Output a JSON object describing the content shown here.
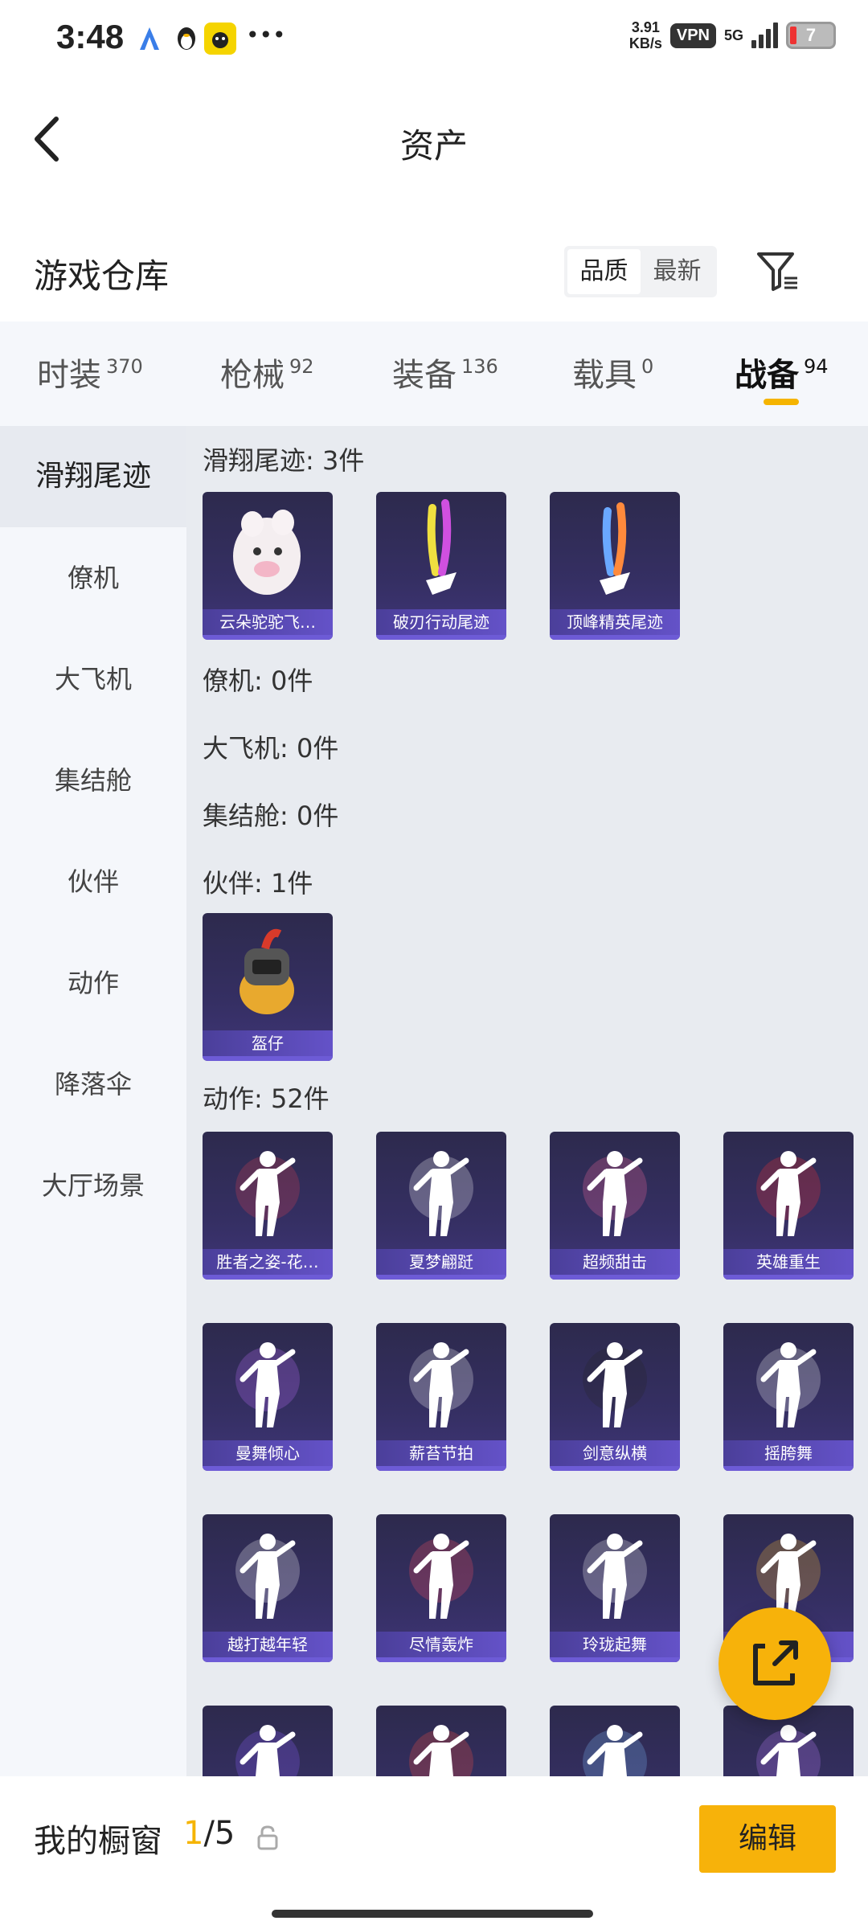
{
  "status_bar": {
    "time": "3:48",
    "speed_value": "3.91",
    "speed_unit": "KB/s",
    "vpn": "VPN",
    "network": "5G",
    "battery": "7"
  },
  "header": {
    "title": "资产"
  },
  "warehouse": {
    "title": "游戏仓库",
    "sort_options": [
      "品质",
      "最新"
    ],
    "active_sort": "品质"
  },
  "tabs": [
    {
      "label": "时装",
      "count": "370"
    },
    {
      "label": "枪械",
      "count": "92"
    },
    {
      "label": "装备",
      "count": "136"
    },
    {
      "label": "载具",
      "count": "0"
    },
    {
      "label": "战备",
      "count": "94"
    }
  ],
  "active_tab": "战备",
  "sidebar": {
    "items": [
      "滑翔尾迹",
      "僚机",
      "大飞机",
      "集结舱",
      "伙伴",
      "动作",
      "降落伞",
      "大厅场景"
    ],
    "active": "滑翔尾迹"
  },
  "sections": {
    "glide": {
      "label": "滑翔尾迹: 3件",
      "items": [
        "云朵驼驼飞…",
        "破刃行动尾迹",
        "顶峰精英尾迹"
      ]
    },
    "wingman": {
      "label": "僚机: 0件"
    },
    "plane": {
      "label": "大飞机: 0件"
    },
    "pod": {
      "label": "集结舱: 0件"
    },
    "partner": {
      "label": "伙伴: 1件",
      "items": [
        "盔仔"
      ]
    },
    "emote": {
      "label": "动作: 52件",
      "items": [
        "胜者之姿-花…",
        "夏梦翩跹",
        "超频甜击",
        "英雄重生",
        "曼舞倾心",
        "薪苔节拍",
        "剑意纵横",
        "摇胯舞",
        "越打越年轻",
        "尽情轰炸",
        "玲珑起舞",
        "",
        "",
        "",
        "",
        ""
      ]
    }
  },
  "bottom_bar": {
    "label": "我的橱窗",
    "current": "1",
    "total": "/5",
    "edit": "编辑"
  },
  "colors": {
    "accent": "#f5b400",
    "card_bg": "#2d2a4d",
    "card_label": "#6452c8"
  }
}
